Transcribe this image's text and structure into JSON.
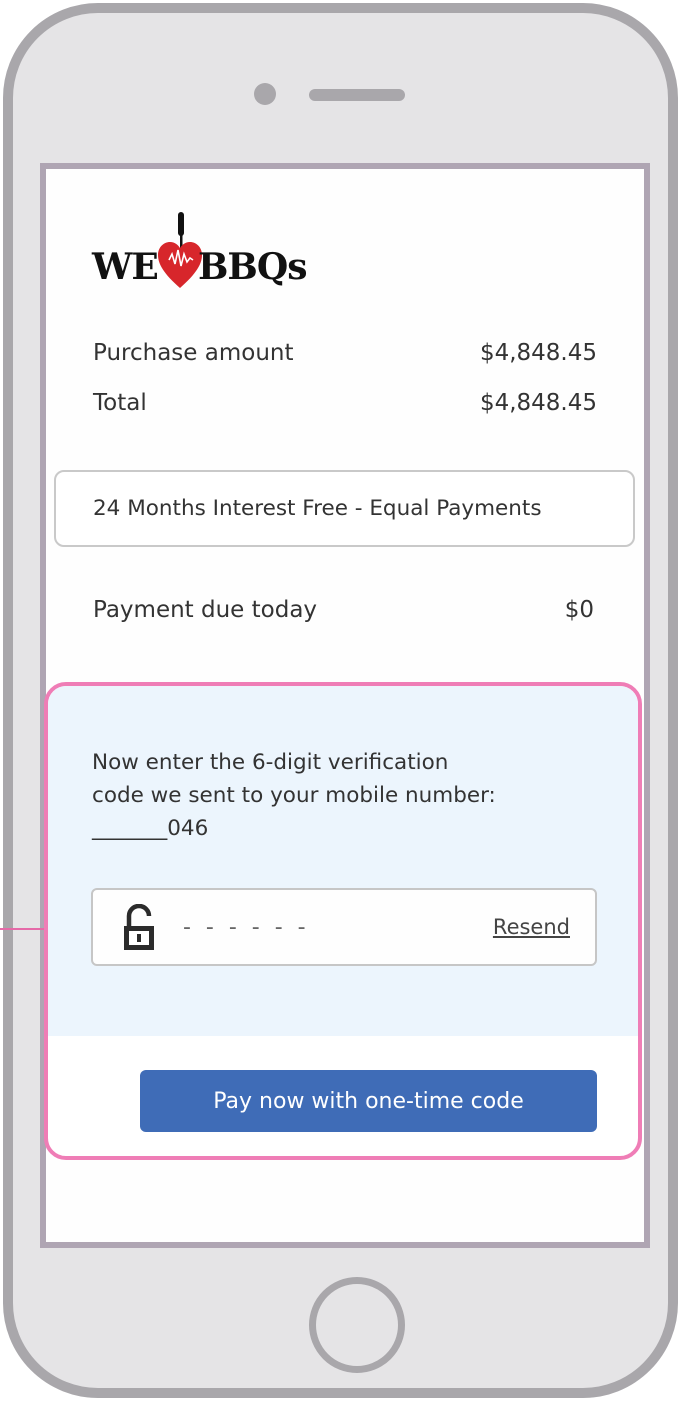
{
  "brand": {
    "logo_left": "WE",
    "logo_right": "BBQs",
    "heart_color": "#d7262b",
    "icon": "bbq-fork-heart-icon"
  },
  "summary": {
    "purchase_label": "Purchase amount",
    "purchase_value": "$4,848.45",
    "total_label": "Total",
    "total_value": "$4,848.45",
    "plan_text": "24 Months Interest Free - Equal Payments",
    "due_label": "Payment due today",
    "due_value": "$0"
  },
  "verification": {
    "message_line1": "Now enter the 6-digit verification",
    "message_line2": "code we sent to your mobile number:",
    "masked_number": "_______046",
    "code_placeholder": "- - - - - -",
    "lock_icon": "unlocked-padlock-icon",
    "resend_label": "Resend",
    "pay_button_label": "Pay now with one-time code"
  },
  "colors": {
    "highlight_border": "#ef7db6",
    "section_background": "#ecf5fd",
    "button_blue": "#3f6cb7"
  }
}
